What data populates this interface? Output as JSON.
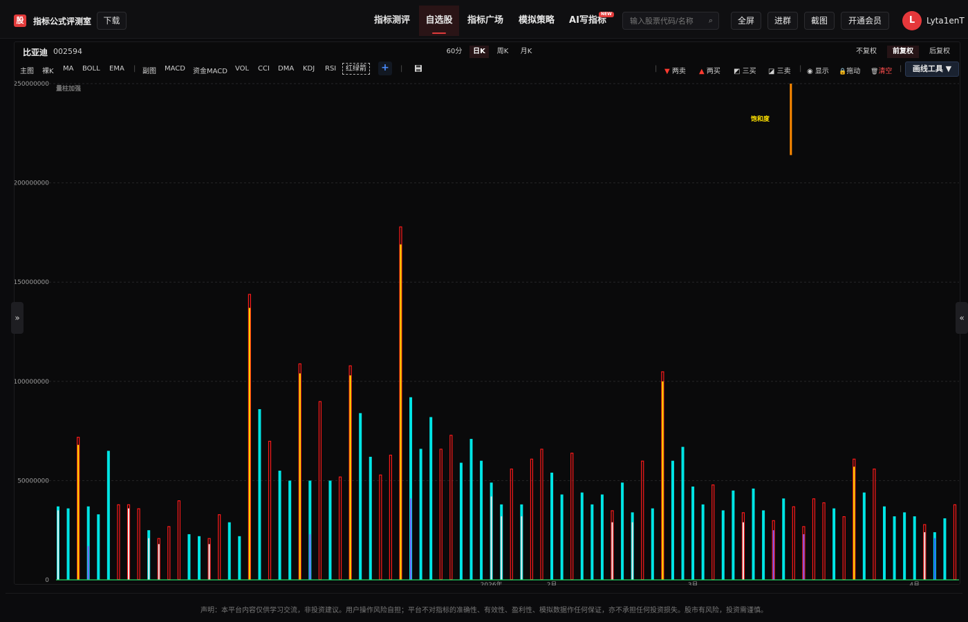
{
  "app": {
    "logo_char": "股",
    "brand": "指标公式评测室",
    "download": "下载"
  },
  "nav": [
    "指标测评",
    "自选股",
    "指标广场",
    "模拟策略",
    "AI写指标"
  ],
  "nav_active": 1,
  "new_badge": "NEW",
  "search": {
    "placeholder": "输入股票代码/名称"
  },
  "top_buttons": [
    "全屏",
    "进群",
    "截图",
    "开通会员"
  ],
  "user": {
    "avatar": "L",
    "name": "Lyta1enT"
  },
  "stock": {
    "name": "比亚迪",
    "code": "002594"
  },
  "periods": [
    "60分",
    "日K",
    "周K",
    "月K"
  ],
  "period_active": 1,
  "adjustments": [
    "不复权",
    "前复权",
    "后复权"
  ],
  "adjust_active": 1,
  "toolbar_left": [
    "主图",
    "裸K",
    "MA",
    "BOLL",
    "EMA"
  ],
  "toolbar_sub": [
    "副图",
    "MACD",
    "资金MACD",
    "VOL",
    "CCI",
    "DMA",
    "KDJ",
    "RSI"
  ],
  "toolbar_redgreen": "红绿箭",
  "add_label": "+",
  "toolbar_right": [
    {
      "icon": "▼",
      "label": "两卖",
      "color": "#ff3b30"
    },
    {
      "icon": "▲",
      "label": "两买",
      "color": "#ff3b30"
    },
    {
      "icon": "◩",
      "label": "三买",
      "color": "#cfcfcf"
    },
    {
      "icon": "◪",
      "label": "三卖",
      "color": "#cfcfcf"
    },
    {
      "icon": "◉",
      "label": "显示",
      "color": "#cfcfcf"
    },
    {
      "icon": "🔒",
      "label": "拖动",
      "color": "#e0b040"
    },
    {
      "icon": "🗑",
      "label": "清空",
      "color": "#cfcfcf"
    }
  ],
  "draw_tools": "画线工具 ▼",
  "left_handle": "»",
  "right_handle": "«",
  "disclaimer": "声明：本平台内容仅供学习交流，非投资建议。用户操作风险自担；平台不对指标的准确性、有效性、盈利性、模拟数据作任何保证，亦不承担任何投资损失。股市有风险，投资需谨慎。",
  "chart_data": {
    "type": "bar",
    "indicator_label": "量柱加强",
    "annotation": "饱和度",
    "ylim": [
      0,
      250000000
    ],
    "yticks": [
      0,
      50000000,
      100000000,
      150000000,
      200000000,
      250000000
    ],
    "ytick_labels": [
      "0",
      "50000000",
      "100000000",
      "150000000",
      "200000000",
      "250000000"
    ],
    "xtick_labels": [
      {
        "index": 43,
        "label": "2026年"
      },
      {
        "index": 49,
        "label": "2月"
      },
      {
        "index": 63,
        "label": "3月"
      },
      {
        "index": 85,
        "label": "4月"
      }
    ],
    "colors": {
      "cyan": "#00e5e5",
      "red_outline": "#ff1a1a",
      "yellow": "#ffd000",
      "orange": "#ff8a00",
      "white_inner": "#e6e6e6",
      "purple_inner": "#7a5cff",
      "blue_inner": "#2a55ff",
      "baseline": "#22dd66",
      "grid": "#262629"
    },
    "saturation_range": [
      214000000,
      250000000
    ],
    "bars": [
      {
        "v": 37000000,
        "t": "cyan",
        "inner": 35000000,
        "ic": "white"
      },
      {
        "v": 36000000,
        "t": "cyan"
      },
      {
        "v": 72000000,
        "t": "red",
        "inner": 68000000,
        "ic": "yellow"
      },
      {
        "v": 37000000,
        "t": "cyan",
        "inner": 17000000,
        "ic": "purple"
      },
      {
        "v": 33000000,
        "t": "cyan"
      },
      {
        "v": 65000000,
        "t": "cyan"
      },
      {
        "v": 38000000,
        "t": "red"
      },
      {
        "v": 38000000,
        "t": "red",
        "inner": 36000000,
        "ic": "white"
      },
      {
        "v": 36000000,
        "t": "red"
      },
      {
        "v": 25000000,
        "t": "cyan",
        "inner": 21000000,
        "ic": "white"
      },
      {
        "v": 21000000,
        "t": "red",
        "inner": 18000000,
        "ic": "white"
      },
      {
        "v": 27000000,
        "t": "red"
      },
      {
        "v": 40000000,
        "t": "red"
      },
      {
        "v": 23000000,
        "t": "cyan"
      },
      {
        "v": 22000000,
        "t": "cyan"
      },
      {
        "v": 21000000,
        "t": "red",
        "inner": 18000000,
        "ic": "white"
      },
      {
        "v": 33000000,
        "t": "red"
      },
      {
        "v": 29000000,
        "t": "cyan"
      },
      {
        "v": 22000000,
        "t": "cyan"
      },
      {
        "v": 144000000,
        "t": "red",
        "inner": 137000000,
        "ic": "yellow"
      },
      {
        "v": 86000000,
        "t": "cyan"
      },
      {
        "v": 70000000,
        "t": "red"
      },
      {
        "v": 55000000,
        "t": "cyan"
      },
      {
        "v": 50000000,
        "t": "cyan"
      },
      {
        "v": 109000000,
        "t": "red",
        "inner": 104000000,
        "ic": "yellow"
      },
      {
        "v": 50000000,
        "t": "cyan",
        "inner": 23000000,
        "ic": "purple"
      },
      {
        "v": 90000000,
        "t": "red"
      },
      {
        "v": 50000000,
        "t": "cyan"
      },
      {
        "v": 52000000,
        "t": "red"
      },
      {
        "v": 108000000,
        "t": "red",
        "inner": 103000000,
        "ic": "yellow"
      },
      {
        "v": 84000000,
        "t": "cyan"
      },
      {
        "v": 62000000,
        "t": "cyan"
      },
      {
        "v": 53000000,
        "t": "red"
      },
      {
        "v": 63000000,
        "t": "red"
      },
      {
        "v": 178000000,
        "t": "red",
        "inner": 169000000,
        "ic": "yellow"
      },
      {
        "v": 92000000,
        "t": "cyan",
        "inner": 41000000,
        "ic": "purple"
      },
      {
        "v": 66000000,
        "t": "cyan"
      },
      {
        "v": 82000000,
        "t": "cyan"
      },
      {
        "v": 66000000,
        "t": "red"
      },
      {
        "v": 73000000,
        "t": "red"
      },
      {
        "v": 59000000,
        "t": "cyan"
      },
      {
        "v": 71000000,
        "t": "cyan"
      },
      {
        "v": 60000000,
        "t": "cyan"
      },
      {
        "v": 49000000,
        "t": "cyan",
        "inner": 42000000,
        "ic": "white"
      },
      {
        "v": 38000000,
        "t": "cyan",
        "inner": 32000000,
        "ic": "white"
      },
      {
        "v": 56000000,
        "t": "red"
      },
      {
        "v": 38000000,
        "t": "cyan",
        "inner": 32000000,
        "ic": "white"
      },
      {
        "v": 61000000,
        "t": "red"
      },
      {
        "v": 66000000,
        "t": "red"
      },
      {
        "v": 54000000,
        "t": "cyan"
      },
      {
        "v": 43000000,
        "t": "cyan"
      },
      {
        "v": 64000000,
        "t": "red"
      },
      {
        "v": 44000000,
        "t": "cyan"
      },
      {
        "v": 38000000,
        "t": "cyan"
      },
      {
        "v": 43000000,
        "t": "cyan"
      },
      {
        "v": 35000000,
        "t": "red",
        "inner": 29000000,
        "ic": "white"
      },
      {
        "v": 49000000,
        "t": "cyan"
      },
      {
        "v": 34000000,
        "t": "cyan",
        "inner": 29000000,
        "ic": "white"
      },
      {
        "v": 60000000,
        "t": "red"
      },
      {
        "v": 36000000,
        "t": "cyan"
      },
      {
        "v": 105000000,
        "t": "red",
        "inner": 100000000,
        "ic": "yellow"
      },
      {
        "v": 60000000,
        "t": "cyan"
      },
      {
        "v": 67000000,
        "t": "cyan"
      },
      {
        "v": 47000000,
        "t": "cyan"
      },
      {
        "v": 38000000,
        "t": "cyan"
      },
      {
        "v": 48000000,
        "t": "red"
      },
      {
        "v": 35000000,
        "t": "cyan"
      },
      {
        "v": 45000000,
        "t": "cyan"
      },
      {
        "v": 34000000,
        "t": "red",
        "inner": 29000000,
        "ic": "white"
      },
      {
        "v": 46000000,
        "t": "cyan"
      },
      {
        "v": 35000000,
        "t": "cyan"
      },
      {
        "v": 30000000,
        "t": "red",
        "inner": 25000000,
        "ic": "purple"
      },
      {
        "v": 41000000,
        "t": "cyan"
      },
      {
        "v": 37000000,
        "t": "red"
      },
      {
        "v": 27000000,
        "t": "red",
        "inner": 23000000,
        "ic": "purple"
      },
      {
        "v": 41000000,
        "t": "red"
      },
      {
        "v": 39000000,
        "t": "red"
      },
      {
        "v": 36000000,
        "t": "cyan"
      },
      {
        "v": 32000000,
        "t": "red"
      },
      {
        "v": 61000000,
        "t": "red",
        "inner": 57000000,
        "ic": "yellow"
      },
      {
        "v": 44000000,
        "t": "cyan"
      },
      {
        "v": 56000000,
        "t": "red"
      },
      {
        "v": 37000000,
        "t": "cyan"
      },
      {
        "v": 32000000,
        "t": "cyan"
      },
      {
        "v": 34000000,
        "t": "cyan"
      },
      {
        "v": 32000000,
        "t": "cyan"
      },
      {
        "v": 28000000,
        "t": "red",
        "inner": 24000000,
        "ic": "white"
      },
      {
        "v": 24000000,
        "t": "cyan",
        "inner": 21000000,
        "ic": "blue"
      },
      {
        "v": 31000000,
        "t": "cyan"
      },
      {
        "v": 38000000,
        "t": "red"
      }
    ]
  }
}
